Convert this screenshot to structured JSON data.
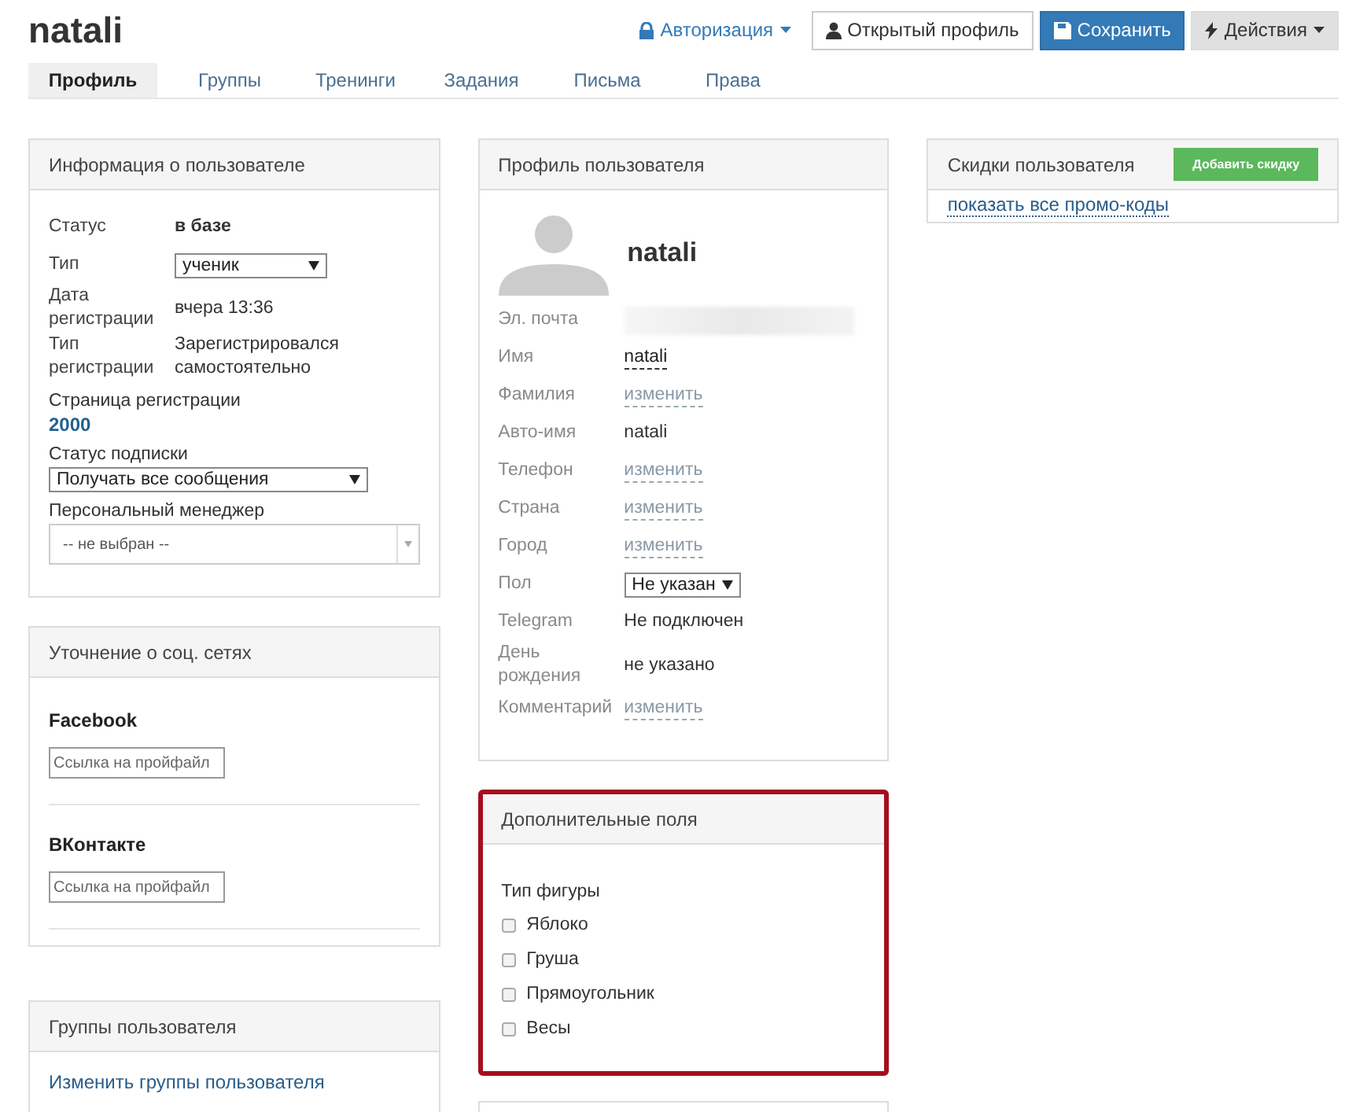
{
  "header": {
    "title": "natali",
    "actions": [
      {
        "kind": "link",
        "label": "Авторизация",
        "caret": true
      },
      {
        "kind": "default",
        "label": "Открытый профиль",
        "caret": false
      },
      {
        "kind": "primary",
        "label": "Сохранить",
        "caret": false
      },
      {
        "kind": "muted",
        "label": "Действия",
        "caret": true
      }
    ]
  },
  "tabs": [
    {
      "label": "Профиль",
      "selected": true
    },
    {
      "label": "Группы",
      "selected": false
    },
    {
      "label": "Тренинги",
      "selected": false
    },
    {
      "label": "Задания",
      "selected": false
    },
    {
      "label": "Письма",
      "selected": false
    },
    {
      "label": "Права",
      "selected": false
    }
  ],
  "user_info": {
    "title": "Информация о пользователе",
    "rows": [
      {
        "label": "Статус",
        "value": "в базе",
        "kind": "bold"
      },
      {
        "label": "Тип",
        "value": "ученик",
        "kind": "select"
      },
      {
        "label": "Дата регистрации",
        "value": "вчера 13:36",
        "kind": "text"
      },
      {
        "label": "Тип регистрации",
        "value": "Зарегистрировался самостоятельно",
        "kind": "text"
      }
    ],
    "stacked": [
      {
        "label": "Страница регистрации",
        "value": "2000",
        "kind": "link"
      },
      {
        "label": "Статус подписки",
        "value": "Получать все сообщения",
        "kind": "select"
      },
      {
        "label": "Персональный менеджер",
        "value": "-- не выбран --",
        "kind": "combo"
      }
    ]
  },
  "social": {
    "title": "Уточнение о соц. сетях",
    "networks": [
      {
        "name": "Facebook",
        "placeholder": "Ссылка на пройфайл"
      },
      {
        "name": "ВКонтакте",
        "placeholder": "Ссылка на пройфайл"
      }
    ]
  },
  "groups": {
    "title": "Группы пользователя",
    "link": "Изменить группы пользователя"
  },
  "profile": {
    "title": "Профиль пользователя",
    "name": "natali",
    "rows": [
      {
        "label": "Эл. почта",
        "kind": "blurred"
      },
      {
        "label": "Имя",
        "value": "natali",
        "kind": "dashed"
      },
      {
        "label": "Фамилия",
        "value": "изменить",
        "kind": "edit"
      },
      {
        "label": "Авто-имя",
        "value": "natali",
        "kind": "text"
      },
      {
        "label": "Телефон",
        "value": "изменить",
        "kind": "edit"
      },
      {
        "label": "Страна",
        "value": "изменить",
        "kind": "edit"
      },
      {
        "label": "Город",
        "value": "изменить",
        "kind": "edit"
      },
      {
        "label": "Пол",
        "value": "Не указан",
        "kind": "select"
      },
      {
        "label": "Telegram",
        "value": "Не подключен",
        "kind": "text"
      },
      {
        "label": "День рождения",
        "value": "не указано",
        "kind": "text"
      },
      {
        "label": "Комментарий",
        "value": "изменить",
        "kind": "edit"
      }
    ]
  },
  "extra_fields": {
    "title": "Дополнительные поля",
    "highlighted": true,
    "group_label": "Тип фигуры",
    "options": [
      {
        "label": "Яблоко",
        "checked": false
      },
      {
        "label": "Груша",
        "checked": false
      },
      {
        "label": "Прямоугольник",
        "checked": false
      },
      {
        "label": "Весы",
        "checked": false
      }
    ]
  },
  "discounts": {
    "title": "Скидки пользователя",
    "button": "Добавить скидку",
    "link": "показать все промо-коды"
  }
}
